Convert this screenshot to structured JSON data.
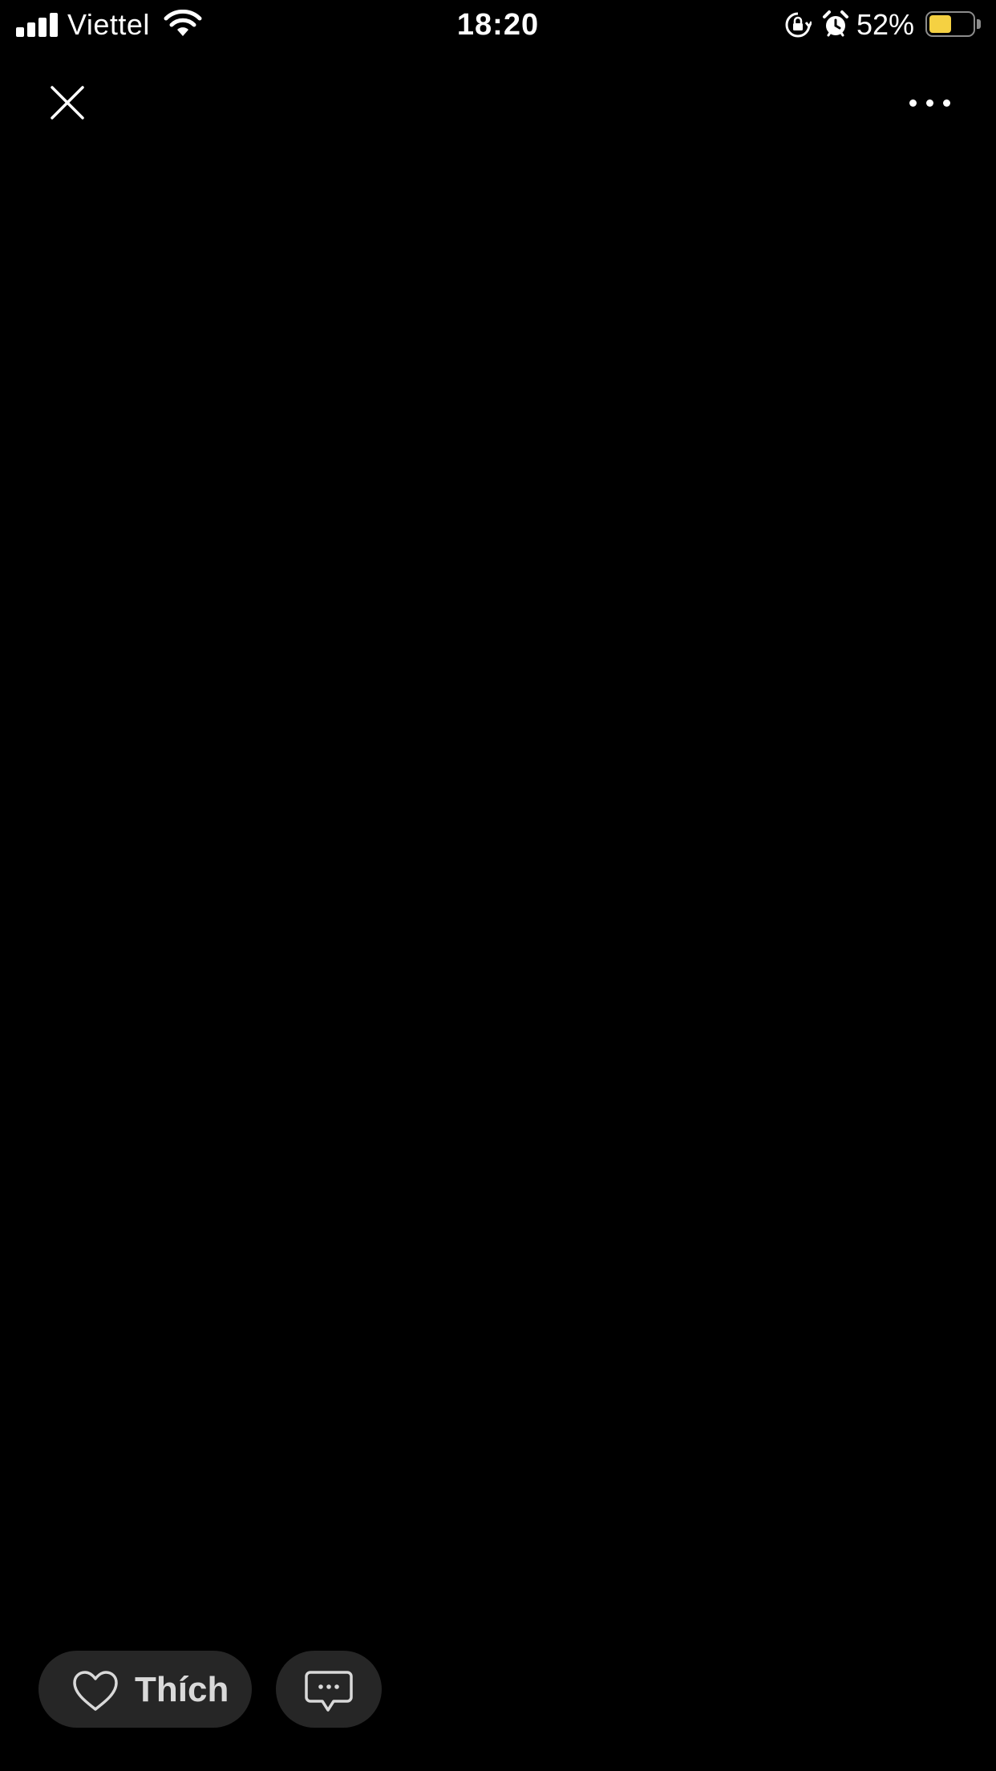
{
  "status_bar": {
    "carrier": "Viettel",
    "time": "18:20",
    "battery_percent_label": "52%",
    "battery_level": 0.52,
    "battery_color": "#f5d142",
    "signal_bars": 4,
    "icons": [
      "signal-icon",
      "wifi-icon",
      "rotation-lock-icon",
      "alarm-icon",
      "battery-icon"
    ]
  },
  "toolbar": {
    "close_icon": "close-icon",
    "more_icon": "more-horizontal-icon"
  },
  "actions": {
    "like_label": "Thích",
    "like_icon": "heart-outline-icon",
    "comment_icon": "comment-bubble-icon"
  },
  "theme": {
    "background": "#000000",
    "button_background": "#262626",
    "icon_color": "#ffffff",
    "label_color": "#d9d9d9"
  }
}
